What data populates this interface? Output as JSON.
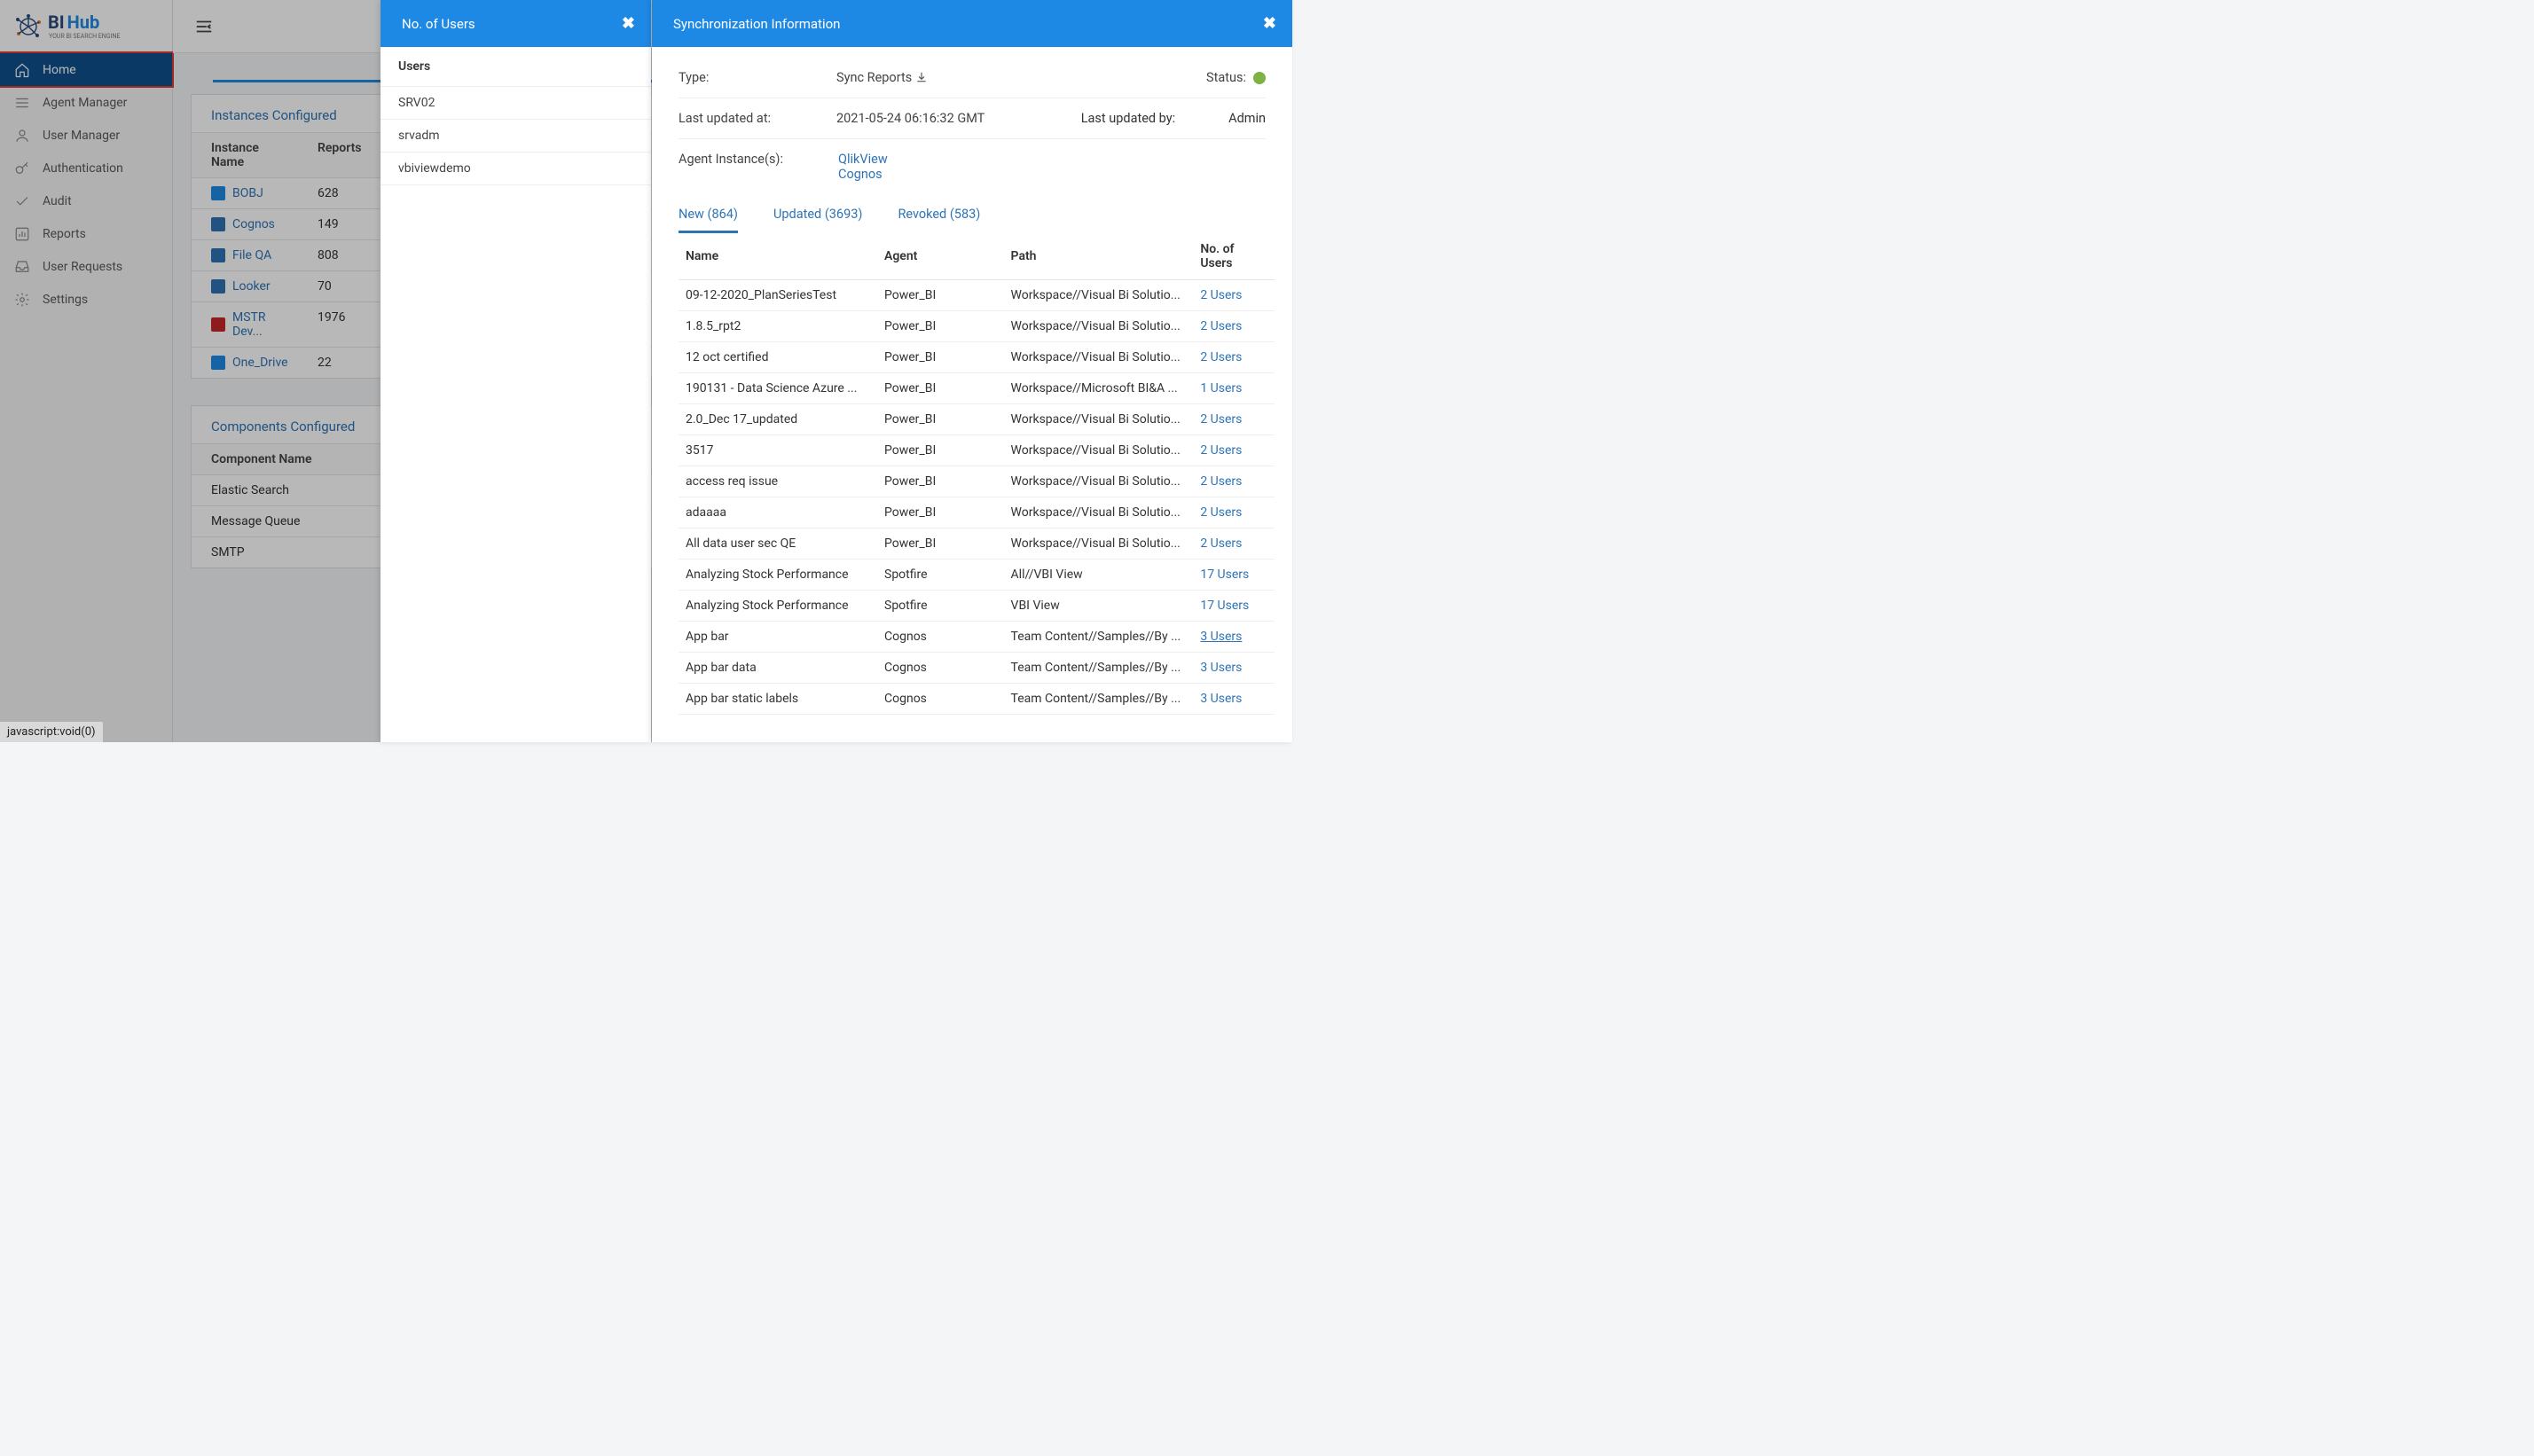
{
  "logo": {
    "brand_primary": "BI",
    "brand_accent": "Hub",
    "tagline": "YOUR BI SEARCH ENGINE"
  },
  "sidebar": {
    "items": [
      {
        "label": "Home",
        "active": true
      },
      {
        "label": "Agent Manager"
      },
      {
        "label": "User Manager"
      },
      {
        "label": "Authentication"
      },
      {
        "label": "Audit"
      },
      {
        "label": "Reports"
      },
      {
        "label": "User Requests"
      },
      {
        "label": "Settings"
      }
    ]
  },
  "instances": {
    "title": "Instances Configured",
    "headers": {
      "name": "Instance Name",
      "reports": "Reports"
    },
    "rows": [
      {
        "name": "BOBJ",
        "reports": "628"
      },
      {
        "name": "Cognos",
        "reports": "149"
      },
      {
        "name": "File QA",
        "reports": "808"
      },
      {
        "name": "Looker",
        "reports": "70"
      },
      {
        "name": "MSTR Dev...",
        "reports": "1976"
      },
      {
        "name": "One_Drive",
        "reports": "22"
      }
    ]
  },
  "components": {
    "title": "Components Configured",
    "headers": {
      "name": "Component Name"
    },
    "rows": [
      "Elastic Search",
      "Message Queue",
      "SMTP"
    ]
  },
  "users_panel": {
    "title": "No. of Users",
    "header": "Users",
    "rows": [
      "SRV02",
      "srvadm",
      "vbiviewdemo"
    ]
  },
  "sync_panel": {
    "title": "Synchronization Information",
    "type_label": "Type:",
    "type_value": "Sync Reports",
    "status_label": "Status:",
    "updated_at_label": "Last updated at:",
    "updated_at_value": "2021-05-24 06:16:32 GMT",
    "updated_by_label": "Last updated by:",
    "updated_by_value": "Admin",
    "agents_label": "Agent Instance(s):",
    "agent_instances": [
      "QlikView",
      "Cognos"
    ],
    "tabs": [
      {
        "label": "New (864)",
        "active": true
      },
      {
        "label": "Updated (3693)"
      },
      {
        "label": "Revoked (583)"
      }
    ],
    "table": {
      "headers": {
        "name": "Name",
        "agent": "Agent",
        "path": "Path",
        "users": "No. of Users"
      },
      "rows": [
        {
          "name": "09-12-2020_PlanSeriesTest",
          "agent": "Power_BI",
          "path": "Workspace//Visual Bi Solutio...",
          "users": "2 Users"
        },
        {
          "name": "1.8.5_rpt2",
          "agent": "Power_BI",
          "path": "Workspace//Visual Bi Solutio...",
          "users": "2 Users"
        },
        {
          "name": "12 oct certified",
          "agent": "Power_BI",
          "path": "Workspace//Visual Bi Solutio...",
          "users": "2 Users"
        },
        {
          "name": "190131 - Data Science Azure ...",
          "agent": "Power_BI",
          "path": "Workspace//Microsoft BI&A ...",
          "users": "1 Users"
        },
        {
          "name": "2.0_Dec 17_updated",
          "agent": "Power_BI",
          "path": "Workspace//Visual Bi Solutio...",
          "users": "2 Users"
        },
        {
          "name": "3517",
          "agent": "Power_BI",
          "path": "Workspace//Visual Bi Solutio...",
          "users": "2 Users"
        },
        {
          "name": "access req issue",
          "agent": "Power_BI",
          "path": "Workspace//Visual Bi Solutio...",
          "users": "2 Users"
        },
        {
          "name": "adaaaa",
          "agent": "Power_BI",
          "path": "Workspace//Visual Bi Solutio...",
          "users": "2 Users"
        },
        {
          "name": "All data user sec QE",
          "agent": "Power_BI",
          "path": "Workspace//Visual Bi Solutio...",
          "users": "2 Users"
        },
        {
          "name": "Analyzing Stock Performance",
          "agent": "Spotfire",
          "path": "All//VBI View",
          "users": "17 Users"
        },
        {
          "name": "Analyzing Stock Performance",
          "agent": "Spotfire",
          "path": "VBI View",
          "users": "17 Users"
        },
        {
          "name": "App bar",
          "agent": "Cognos",
          "path": "Team Content//Samples//By ...",
          "users": "3 Users",
          "underlined": true
        },
        {
          "name": "App bar data",
          "agent": "Cognos",
          "path": "Team Content//Samples//By ...",
          "users": "3 Users"
        },
        {
          "name": "App bar static labels",
          "agent": "Cognos",
          "path": "Team Content//Samples//By ...",
          "users": "3 Users"
        }
      ]
    }
  },
  "statusbar": "javascript:void(0)"
}
